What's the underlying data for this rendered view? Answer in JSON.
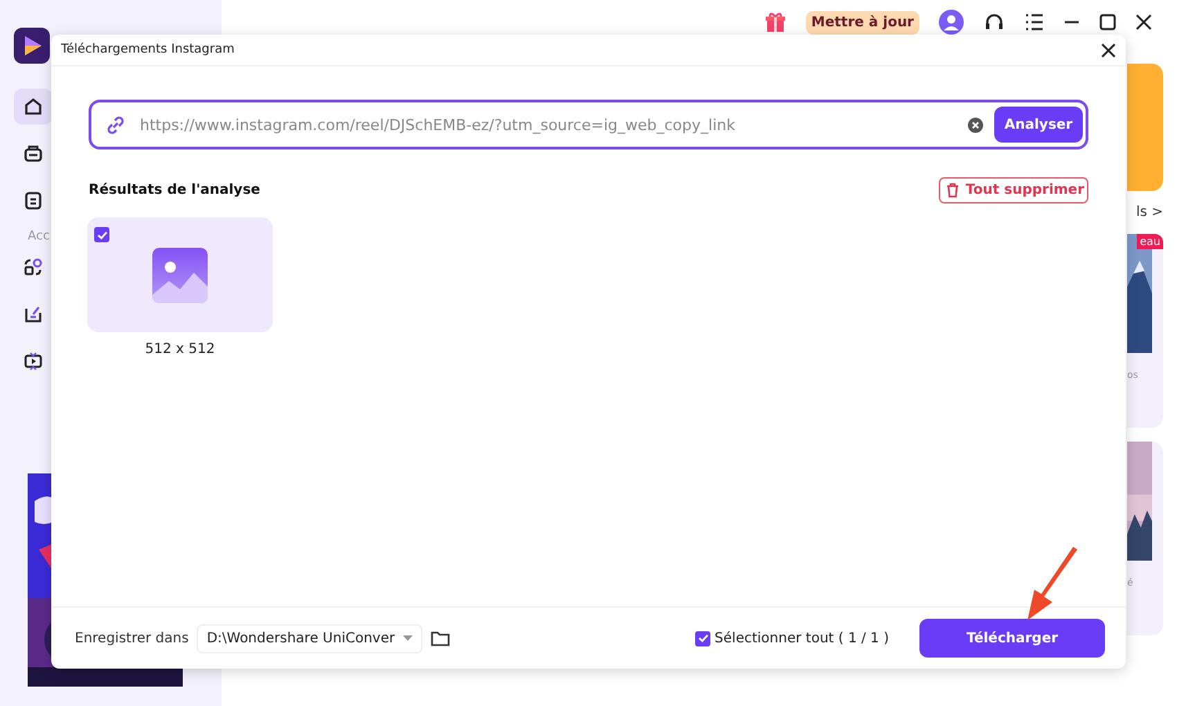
{
  "sidebar": {
    "items": [
      {
        "selected": true
      },
      {
        "selected": false
      },
      {
        "selected": false
      }
    ],
    "section_label": "Acc"
  },
  "topbar": {
    "update_button": "Mettre à jour"
  },
  "background": {
    "link": "ls >",
    "cards": [
      {
        "badge": "eau",
        "caption": "os"
      },
      {
        "caption": "é"
      }
    ]
  },
  "dialog": {
    "title": "Téléchargements Instagram",
    "url": "https://www.instagram.com/reel/DJSchEMB-ez/?utm_source=ig_web_copy_link",
    "analyze_button": "Analyser",
    "results_heading": "Résultats de l'analyse",
    "delete_all_button": "Tout supprimer",
    "results": [
      {
        "size": "512 x 512",
        "checked": true
      }
    ],
    "save_label": "Enregistrer dans",
    "save_path": "D:\\Wondershare UniConver",
    "select_all": {
      "label": "Sélectionner tout ( 1 / 1 )",
      "checked": true
    },
    "download_button": "Télécharger"
  }
}
